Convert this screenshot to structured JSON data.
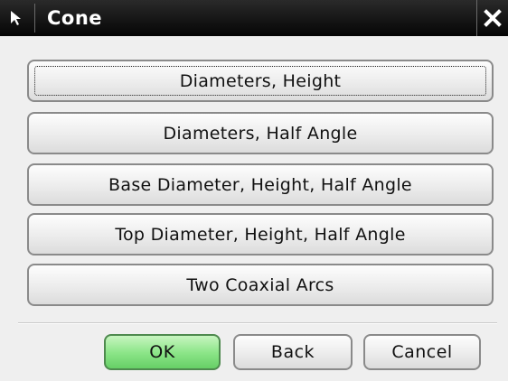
{
  "window": {
    "title": "Cone",
    "icon": "cursor-arrow-icon",
    "close_icon": "close-icon"
  },
  "options": [
    {
      "label": "Diameters, Height",
      "focused": true
    },
    {
      "label": "Diameters, Half Angle",
      "focused": false
    },
    {
      "label": "Base Diameter, Height, Half Angle",
      "focused": false
    },
    {
      "label": "Top Diameter, Height, Half Angle",
      "focused": false
    },
    {
      "label": "Two Coaxial Arcs",
      "focused": false
    }
  ],
  "footer": {
    "ok_label": "OK",
    "back_label": "Back",
    "cancel_label": "Cancel"
  },
  "colors": {
    "titlebar": "#050505",
    "ok_button": "#8ee68a",
    "background": "#efefef"
  }
}
